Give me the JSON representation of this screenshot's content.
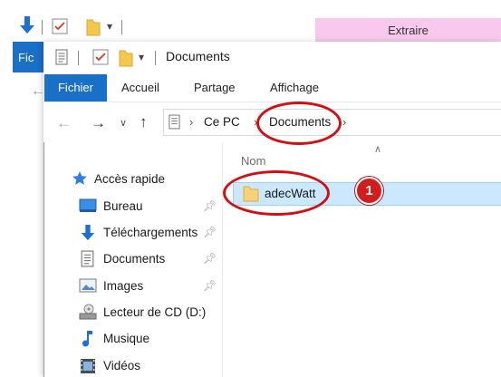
{
  "background_window": {
    "tool_tab_label": "Extraire",
    "ribbon_tab_label": "Fic"
  },
  "window": {
    "title": "Documents"
  },
  "ribbon": {
    "tabs": [
      {
        "label": "Fichier"
      },
      {
        "label": "Accueil"
      },
      {
        "label": "Partage"
      },
      {
        "label": "Affichage"
      }
    ]
  },
  "address_bar": {
    "crumbs": [
      {
        "label": "Ce PC"
      },
      {
        "label": "Documents"
      }
    ]
  },
  "nav_pane": {
    "quick_access_label": "Accès rapide",
    "items": [
      {
        "label": "Bureau",
        "icon": "desktop-icon",
        "pinned": true
      },
      {
        "label": "Téléchargements",
        "icon": "download-arrow-icon",
        "pinned": true
      },
      {
        "label": "Documents",
        "icon": "document-icon",
        "pinned": true
      },
      {
        "label": "Images",
        "icon": "pictures-icon",
        "pinned": true
      },
      {
        "label": "Lecteur de CD (D:)",
        "icon": "cd-drive-icon",
        "pinned": false
      },
      {
        "label": "Musique",
        "icon": "music-note-icon",
        "pinned": false
      },
      {
        "label": "Vidéos",
        "icon": "video-icon",
        "pinned": false
      }
    ]
  },
  "file_list": {
    "column_name": "Nom",
    "items": [
      {
        "name": "adecWatt",
        "icon": "folder-icon",
        "selected": true
      }
    ]
  },
  "annotation": {
    "step_number": "1",
    "color": "#d40f14"
  }
}
